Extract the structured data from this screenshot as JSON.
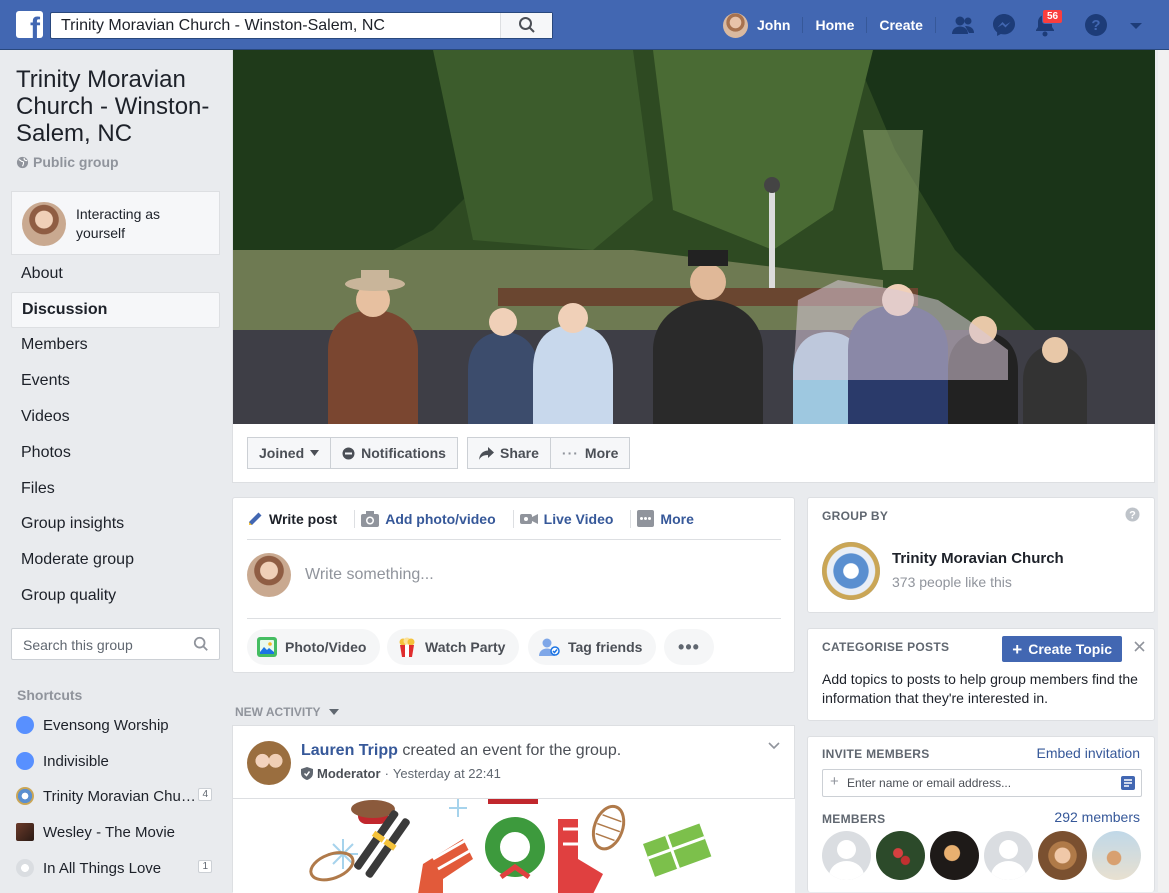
{
  "topbar": {
    "logo": "f",
    "search_value": "Trinity Moravian Church - Winston-Salem, NC",
    "user_name": "John",
    "home": "Home",
    "create": "Create",
    "notifications_count": "56"
  },
  "group": {
    "title": "Trinity Moravian Church - Winston-Salem, NC",
    "privacy": "Public group",
    "interacting": "Interacting as yourself"
  },
  "side_nav": [
    {
      "label": "About"
    },
    {
      "label": "Discussion"
    },
    {
      "label": "Members"
    },
    {
      "label": "Events"
    },
    {
      "label": "Videos"
    },
    {
      "label": "Photos"
    },
    {
      "label": "Files"
    },
    {
      "label": "Group insights"
    },
    {
      "label": "Moderate group"
    },
    {
      "label": "Group quality"
    }
  ],
  "group_search_placeholder": "Search this group",
  "shortcuts": {
    "heading": "Shortcuts",
    "items": [
      {
        "label": "Evensong Worship",
        "count": ""
      },
      {
        "label": "Indivisible",
        "count": ""
      },
      {
        "label": "Trinity Moravian Chu…",
        "count": "4"
      },
      {
        "label": "Wesley - The Movie",
        "count": ""
      },
      {
        "label": "In All Things Love",
        "count": "1"
      }
    ]
  },
  "header_buttons": {
    "joined": "Joined",
    "notifications": "Notifications",
    "share": "Share",
    "more": "More"
  },
  "composer": {
    "tabs": [
      "Write post",
      "Add photo/video",
      "Live Video",
      "More"
    ],
    "placeholder": "Write something...",
    "actions": [
      "Photo/Video",
      "Watch Party",
      "Tag friends"
    ]
  },
  "feed": {
    "section": "NEW ACTIVITY",
    "post": {
      "author": "Lauren Tripp",
      "action": "created an event for the group.",
      "role": "Moderator",
      "time": "Yesterday at 22:41"
    }
  },
  "group_by": {
    "heading": "GROUP BY",
    "name": "Trinity Moravian Church",
    "likes": "373 people like this"
  },
  "categorise": {
    "heading": "CATEGORISE POSTS",
    "button": "Create Topic",
    "text": "Add topics to posts to help group members find the information that they're interested in."
  },
  "invite": {
    "heading": "INVITE MEMBERS",
    "embed_link": "Embed invitation",
    "placeholder": "Enter name or email address...",
    "members_heading": "MEMBERS",
    "members_count": "292 members"
  },
  "colors": {
    "brand": "#4267b2",
    "link": "#365899",
    "badge": "#fa3e3e"
  }
}
